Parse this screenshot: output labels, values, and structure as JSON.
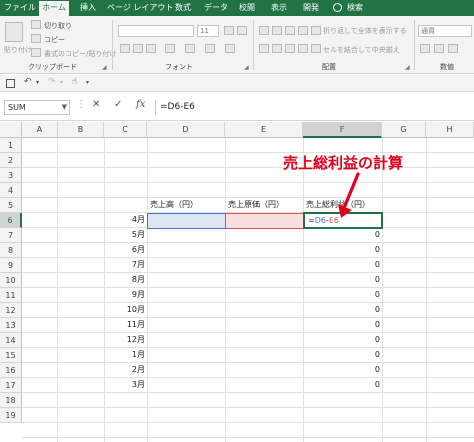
{
  "tabs": [
    {
      "label": "ファイル",
      "active": false
    },
    {
      "label": "ホーム",
      "active": true
    },
    {
      "label": "挿入",
      "active": false
    },
    {
      "label": "ページ レイアウト",
      "active": false
    },
    {
      "label": "数式",
      "active": false
    },
    {
      "label": "データ",
      "active": false
    },
    {
      "label": "校閲",
      "active": false
    },
    {
      "label": "表示",
      "active": false
    },
    {
      "label": "開発",
      "active": false
    },
    {
      "label": "検索",
      "active": false
    }
  ],
  "ribbon": {
    "clipboard": {
      "paste_label": "貼り付け",
      "cut_label": "切り取り",
      "copy_label": "コピー",
      "format_painter_label": "書式のコピー/貼り付け",
      "group_label": "クリップボード"
    },
    "font": {
      "size_value": "11",
      "group_label": "フォント"
    },
    "alignment": {
      "wrap_label": "折り返して全体を表示する",
      "merge_label": "セルを結合して中央揃え",
      "group_label": "配置"
    },
    "number": {
      "format_value": "通貨",
      "group_label": "数値"
    }
  },
  "formula_bar": {
    "name_box": "SUM",
    "fx_label": "fx",
    "formula": "=D6-E6"
  },
  "sheet": {
    "columns": [
      "A",
      "B",
      "C",
      "D",
      "E",
      "F",
      "G",
      "H"
    ],
    "rows": [
      "1",
      "2",
      "3",
      "4",
      "5",
      "6",
      "7",
      "8",
      "9",
      "10",
      "11",
      "12",
      "13",
      "14",
      "15",
      "16",
      "17",
      "18",
      "19"
    ],
    "headers": {
      "sales": "売上高（円）",
      "cost": "売上原価（円）",
      "profit": "売上総利益（円）"
    },
    "months": [
      "4月",
      "5月",
      "6月",
      "7月",
      "8月",
      "9月",
      "10月",
      "11月",
      "12月",
      "1月",
      "2月",
      "3月"
    ],
    "editing_cell": {
      "prefix": "=",
      "ref_d": "D6",
      "op": "-",
      "ref_e": "E6"
    },
    "profit_values": [
      "0",
      "0",
      "0",
      "0",
      "0",
      "0",
      "0",
      "0",
      "0",
      "0",
      "0"
    ]
  },
  "annotation": {
    "text": "売上総利益の計算",
    "color": "#e0001b"
  },
  "colors": {
    "accent": "#217346",
    "ref_d": "#4472c4",
    "ref_e": "#d9534f"
  }
}
